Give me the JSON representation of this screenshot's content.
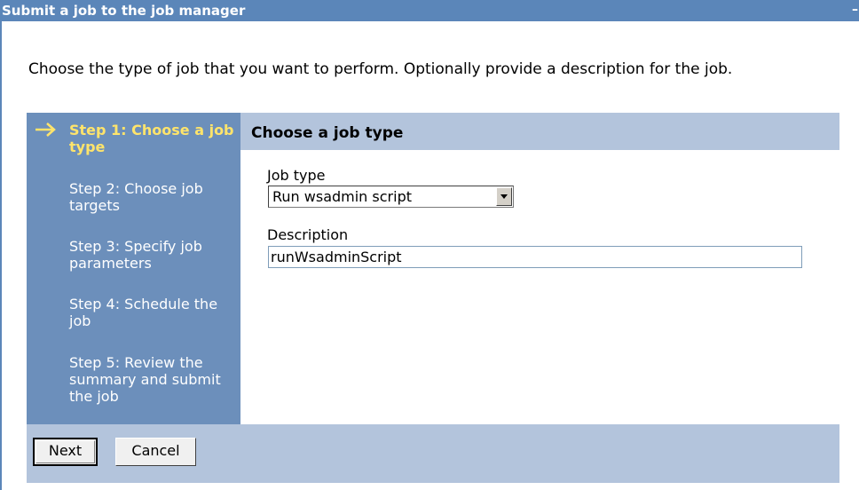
{
  "window": {
    "title": "Submit a job to the job manager",
    "minimize_glyph": "–"
  },
  "intro_text": "Choose the type of job that you want to perform. Optionally provide a description for the job.",
  "steps": [
    {
      "label": "Step 1: Choose a job type",
      "active": true
    },
    {
      "label": "Step 2: Choose job targets",
      "active": false
    },
    {
      "label": "Step 3: Specify job parameters",
      "active": false
    },
    {
      "label": "Step 4: Schedule the job",
      "active": false
    },
    {
      "label": "Step 5: Review the summary and submit the job",
      "active": false
    }
  ],
  "current_step_icon": "arrow-right-icon",
  "content": {
    "title": "Choose a job type",
    "job_type_label": "Job type",
    "job_type_value": "Run wsadmin script",
    "description_label": "Description",
    "description_value": "runWsadminScript"
  },
  "buttons": {
    "next": "Next",
    "cancel": "Cancel"
  },
  "colors": {
    "title_bar": "#5b86b9",
    "step_panel": "#6c8fbb",
    "active_step_text": "#ffe46b",
    "header_band": "#b3c4dc"
  }
}
